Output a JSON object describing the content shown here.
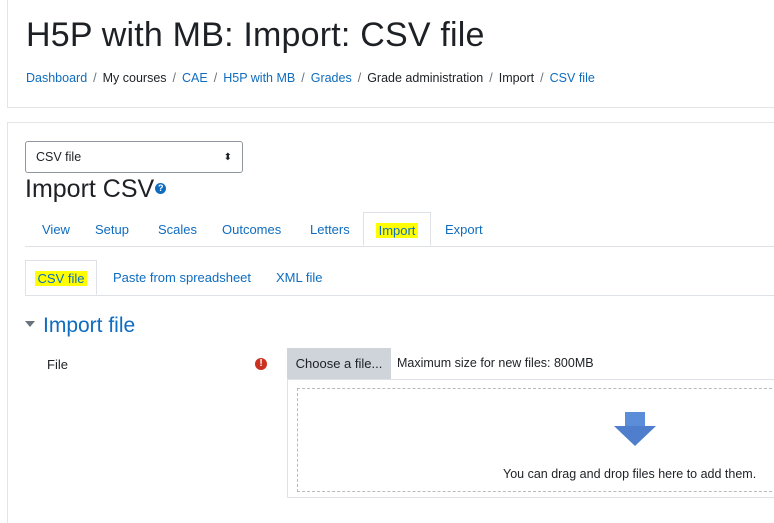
{
  "header": {
    "title": "H5P with MB: Import: CSV file",
    "breadcrumb": {
      "dashboard": "Dashboard",
      "my_courses": "My courses",
      "cae": "CAE",
      "course": "H5P with MB",
      "grades": "Grades",
      "grade_admin": "Grade administration",
      "import": "Import",
      "csv_file": "CSV file",
      "separator": "/"
    }
  },
  "selector": {
    "value": "CSV file",
    "arrows": "⬍"
  },
  "import_heading": "Import CSV",
  "help_icon": "question-circle-icon",
  "tabs": {
    "view": "View",
    "setup": "Setup",
    "scales": "Scales",
    "outcomes": "Outcomes",
    "letters": "Letters",
    "import": "Import",
    "export": "Export",
    "active": "Import"
  },
  "subtabs": {
    "csv": "CSV file",
    "paste": "Paste from spreadsheet",
    "xml": "XML file",
    "active": "CSV file"
  },
  "section": {
    "title": "Import file",
    "collapse_icon": "caret-down-icon"
  },
  "file_field": {
    "label": "File",
    "required_icon": "exclamation-circle-icon",
    "choose_label": "Choose a file...",
    "max_size": "Maximum size for new files: 800MB",
    "drop_text": "You can drag and drop files here to add them.",
    "drop_icon": "arrow-down-icon"
  },
  "colors": {
    "link": "#0f6cbf",
    "highlight": "#ffff00",
    "required": "#ca3120",
    "arrow": "#5b8dd8"
  }
}
